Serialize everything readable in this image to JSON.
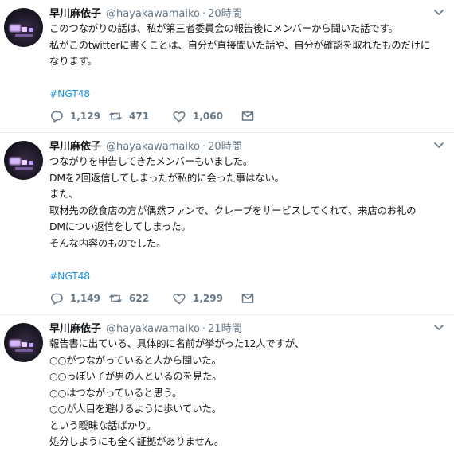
{
  "tweets": [
    {
      "name": "早川麻依子",
      "handle": "@hayakawamaiko",
      "sep": "·",
      "time": "20時間",
      "lines": [
        "このつながりの話は、私が第三者委員会の報告後にメンバーから聞いた話です。",
        "私がこのtwitterに書くことは、自分が直接聞いた話や、自分が確認を取れたものだけに",
        "なります。"
      ],
      "hashtag": "#NGT48",
      "replies": "1,129",
      "retweets": "471",
      "likes": "1,060"
    },
    {
      "name": "早川麻依子",
      "handle": "@hayakawamaiko",
      "sep": "·",
      "time": "20時間",
      "lines": [
        "つながりを申告してきたメンバーもいました。",
        "DMを2回返信してしまったが私的に会った事はない。",
        "また、",
        "取材先の飲食店の方が偶然ファンで、クレープをサービスしてくれて、来店のお礼の",
        "DMについ返信をしてしまった。",
        "そんな内容のものでした。"
      ],
      "hashtag": "#NGT48",
      "replies": "1,149",
      "retweets": "622",
      "likes": "1,299"
    },
    {
      "name": "早川麻依子",
      "handle": "@hayakawamaiko",
      "sep": "·",
      "time": "21時間",
      "lines": [
        "報告書に出ている、具体的に名前が挙がった12人ですが、",
        "○○がつながっていると人から聞いた。",
        "○○っぽい子が男の人といるのを見た。",
        "○○はつながっていると思う。",
        "○○が人目を避けるように歩いていた。",
        "という曖昧な話ばかり。",
        "処分しようにも全く証拠がありません。"
      ]
    }
  ],
  "colors": {
    "text": "#14171a",
    "secondary": "#657786",
    "link": "#1b95e0",
    "divider": "#e6ecf0"
  },
  "icons": [
    "avatar",
    "chevron-down-icon",
    "reply-icon",
    "retweet-icon",
    "like-icon",
    "message-icon"
  ]
}
